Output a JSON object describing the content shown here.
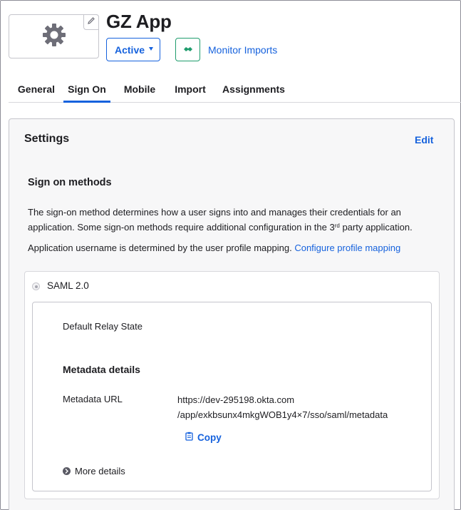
{
  "app": {
    "title": "GZ App"
  },
  "header": {
    "logo_icon": "gear-icon",
    "edit_icon": "pencil-icon",
    "status_label": "Active",
    "import_icon": "handshake-icon",
    "monitor_imports_label": "Monitor Imports"
  },
  "tabs": [
    {
      "label": "General"
    },
    {
      "label": "Sign On",
      "active": true
    },
    {
      "label": "Mobile"
    },
    {
      "label": "Import"
    },
    {
      "label": "Assignments"
    }
  ],
  "settings": {
    "title": "Settings",
    "edit_label": "Edit",
    "methods_title": "Sign on methods",
    "description_part1": "The sign-on method determines how a user signs into and manages their credentials for an application. Some sign-on methods require additional configuration in the 3",
    "description_sup": "rd",
    "description_part2": " party application.",
    "username_text": "Application username is determined by the user profile mapping. ",
    "username_link": "Configure profile mapping"
  },
  "saml": {
    "label": "SAML 2.0",
    "relay_label": "Default Relay State",
    "metadata_title": "Metadata details",
    "metadata_url_label": "Metadata URL",
    "metadata_url_line1": "https://dev-295198.okta.com",
    "metadata_url_line2": "/app/exkbsunx4mkgWOB1y4×7/sso/saml/metadata",
    "copy_label": "Copy",
    "copy_icon": "clipboard-icon",
    "more_details_label": "More details",
    "more_icon": "chevron-right-icon"
  },
  "colors": {
    "accent": "#1662dd",
    "success": "#1f9c6d",
    "text": "#1d1d21"
  }
}
